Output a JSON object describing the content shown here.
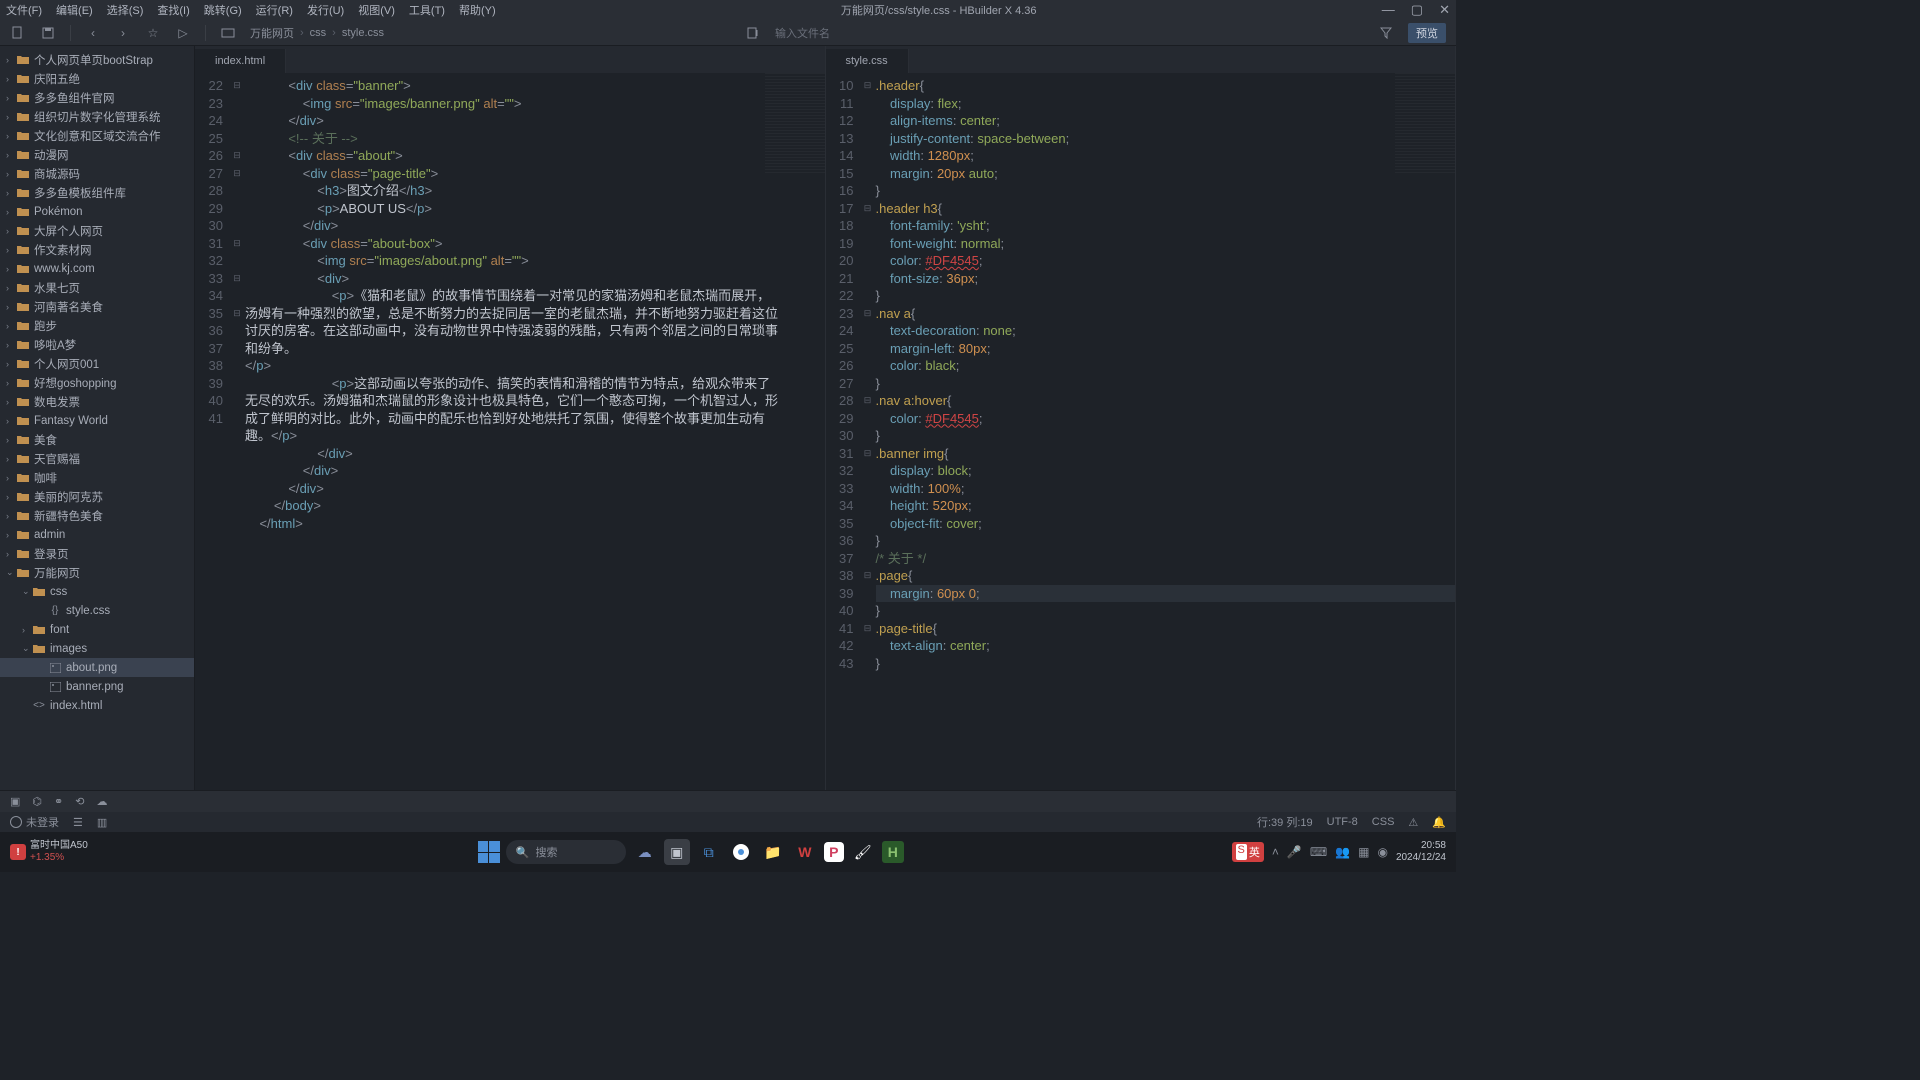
{
  "app": {
    "title": "万能网页/css/style.css - HBuilder X 4.36"
  },
  "menu": [
    "文件(F)",
    "编辑(E)",
    "选择(S)",
    "查找(I)",
    "跳转(G)",
    "运行(R)",
    "发行(U)",
    "视图(V)",
    "工具(T)",
    "帮助(Y)"
  ],
  "breadcrumb": [
    "万能网页",
    "css",
    "style.css"
  ],
  "filename_placeholder": "输入文件名",
  "preview_label": "预览",
  "tabs_left": {
    "active": "index.html"
  },
  "tabs_right": {
    "active": "style.css"
  },
  "sidebar": [
    {
      "name": "个人网页单页bootStrap",
      "type": "folder",
      "depth": 0,
      "chev": "›"
    },
    {
      "name": "庆阳五绝",
      "type": "folder",
      "depth": 0,
      "chev": "›"
    },
    {
      "name": "多多鱼组件官网",
      "type": "folder",
      "depth": 0,
      "chev": "›"
    },
    {
      "name": "组织切片数字化管理系统",
      "type": "folder",
      "depth": 0,
      "chev": "›"
    },
    {
      "name": "文化创意和区域交流合作",
      "type": "folder",
      "depth": 0,
      "chev": "›"
    },
    {
      "name": "动漫网",
      "type": "folder",
      "depth": 0,
      "chev": "›"
    },
    {
      "name": "商城源码",
      "type": "folder",
      "depth": 0,
      "chev": "›"
    },
    {
      "name": "多多鱼模板组件库",
      "type": "folder",
      "depth": 0,
      "chev": "›"
    },
    {
      "name": "Pokémon",
      "type": "folder",
      "depth": 0,
      "chev": "›"
    },
    {
      "name": "大屏个人网页",
      "type": "folder",
      "depth": 0,
      "chev": "›"
    },
    {
      "name": "作文素材网",
      "type": "folder",
      "depth": 0,
      "chev": "›"
    },
    {
      "name": "www.kj.com",
      "type": "folder",
      "depth": 0,
      "chev": "›"
    },
    {
      "name": "水果七页",
      "type": "folder",
      "depth": 0,
      "chev": "›"
    },
    {
      "name": "河南著名美食",
      "type": "folder",
      "depth": 0,
      "chev": "›"
    },
    {
      "name": "跑步",
      "type": "folder",
      "depth": 0,
      "chev": "›"
    },
    {
      "name": "哆啦A梦",
      "type": "folder",
      "depth": 0,
      "chev": "›"
    },
    {
      "name": "个人网页001",
      "type": "folder",
      "depth": 0,
      "chev": "›"
    },
    {
      "name": "好想goshopping",
      "type": "folder",
      "depth": 0,
      "chev": "›"
    },
    {
      "name": "数电发票",
      "type": "folder",
      "depth": 0,
      "chev": "›"
    },
    {
      "name": "Fantasy World",
      "type": "folder",
      "depth": 0,
      "chev": "›"
    },
    {
      "name": "美食",
      "type": "folder",
      "depth": 0,
      "chev": "›"
    },
    {
      "name": "天官赐福",
      "type": "folder",
      "depth": 0,
      "chev": "›"
    },
    {
      "name": "咖啡",
      "type": "folder",
      "depth": 0,
      "chev": "›"
    },
    {
      "name": "美丽的阿克苏",
      "type": "folder",
      "depth": 0,
      "chev": "›"
    },
    {
      "name": "新疆特色美食",
      "type": "folder",
      "depth": 0,
      "chev": "›"
    },
    {
      "name": "admin",
      "type": "folder",
      "depth": 0,
      "chev": "›"
    },
    {
      "name": "登录页",
      "type": "folder",
      "depth": 0,
      "chev": "›"
    },
    {
      "name": "万能网页",
      "type": "folder",
      "depth": 0,
      "chev": "⌄"
    },
    {
      "name": "css",
      "type": "folder",
      "depth": 1,
      "chev": "⌄"
    },
    {
      "name": "style.css",
      "type": "css",
      "depth": 2,
      "chev": ""
    },
    {
      "name": "font",
      "type": "folder",
      "depth": 1,
      "chev": "›"
    },
    {
      "name": "images",
      "type": "folder",
      "depth": 1,
      "chev": "⌄"
    },
    {
      "name": "about.png",
      "type": "img",
      "depth": 2,
      "chev": "",
      "active": true
    },
    {
      "name": "banner.png",
      "type": "img",
      "depth": 2,
      "chev": ""
    },
    {
      "name": "index.html",
      "type": "html",
      "depth": 1,
      "chev": ""
    }
  ],
  "code_left": {
    "start": 22,
    "lines": [
      {
        "n": 22,
        "fold": "⊟",
        "html": "            <span class='t-punc'>&lt;</span><span class='t-tag'>div</span> <span class='t-attr'>class</span><span class='t-punc'>=</span><span class='t-str'>\"banner\"</span><span class='t-punc'>&gt;</span>"
      },
      {
        "n": 23,
        "fold": "",
        "html": "                <span class='t-punc'>&lt;</span><span class='t-tag'>img</span> <span class='t-attr'>src</span><span class='t-punc'>=</span><span class='t-str'>\"images/banner.png\"</span> <span class='t-attr'>alt</span><span class='t-punc'>=</span><span class='t-str'>\"\"</span><span class='t-punc'>&gt;</span>"
      },
      {
        "n": 24,
        "fold": "",
        "html": "            <span class='t-punc'>&lt;/</span><span class='t-tag'>div</span><span class='t-punc'>&gt;</span>"
      },
      {
        "n": 25,
        "fold": "",
        "html": "            <span class='t-comm'>&lt;!-- 关于 --&gt;</span>"
      },
      {
        "n": 26,
        "fold": "⊟",
        "html": "            <span class='t-punc'>&lt;</span><span class='t-tag'>div</span> <span class='t-attr'>class</span><span class='t-punc'>=</span><span class='t-str'>\"about\"</span><span class='t-punc'>&gt;</span>"
      },
      {
        "n": 27,
        "fold": "⊟",
        "html": "                <span class='t-punc'>&lt;</span><span class='t-tag'>div</span> <span class='t-attr'>class</span><span class='t-punc'>=</span><span class='t-str'>\"page-title\"</span><span class='t-punc'>&gt;</span>"
      },
      {
        "n": 28,
        "fold": "",
        "html": "                    <span class='t-punc'>&lt;</span><span class='t-tag'>h3</span><span class='t-punc'>&gt;</span><span class='t-text'>图文介绍</span><span class='t-punc'>&lt;/</span><span class='t-tag'>h3</span><span class='t-punc'>&gt;</span>"
      },
      {
        "n": 29,
        "fold": "",
        "html": "                    <span class='t-punc'>&lt;</span><span class='t-tag'>p</span><span class='t-punc'>&gt;</span><span class='t-text'>ABOUT US</span><span class='t-punc'>&lt;/</span><span class='t-tag'>p</span><span class='t-punc'>&gt;</span>"
      },
      {
        "n": 30,
        "fold": "",
        "html": "                <span class='t-punc'>&lt;/</span><span class='t-tag'>div</span><span class='t-punc'>&gt;</span>"
      },
      {
        "n": 31,
        "fold": "⊟",
        "html": "                <span class='t-punc'>&lt;</span><span class='t-tag'>div</span> <span class='t-attr'>class</span><span class='t-punc'>=</span><span class='t-str'>\"about-box\"</span><span class='t-punc'>&gt;</span>"
      },
      {
        "n": 32,
        "fold": "",
        "html": "                    <span class='t-punc'>&lt;</span><span class='t-tag'>img</span> <span class='t-attr'>src</span><span class='t-punc'>=</span><span class='t-str'>\"images/about.png\"</span> <span class='t-attr'>alt</span><span class='t-punc'>=</span><span class='t-str'>\"\"</span><span class='t-punc'>&gt;</span>"
      },
      {
        "n": 33,
        "fold": "⊟",
        "html": "                    <span class='t-punc'>&lt;</span><span class='t-tag'>div</span><span class='t-punc'>&gt;</span>"
      },
      {
        "n": 34,
        "fold": "",
        "wrap": true,
        "html": "                        <span class='t-punc'>&lt;</span><span class='t-tag'>p</span><span class='t-punc'>&gt;</span><span class='t-text'>《猫和老鼠》的故事情节围绕着一对常见的家猫汤姆和老鼠杰瑞而展开，汤姆有一种强烈的欲望，总是不断努力的去捉同居一室的老鼠杰瑞，并不断地努力驱赶着这位讨厌的房客。在这部动画中，没有动物世界中恃强凌弱的残酷，只有两个邻居之间的日常琐事和纷争。</span>"
      },
      {
        "n": 35,
        "fold": "⊟",
        "html": "<span class='t-punc'>&lt;/</span><span class='t-tag'>p</span><span class='t-punc'>&gt;</span>"
      },
      {
        "n": 36,
        "fold": "",
        "wrap": true,
        "html": "                        <span class='t-punc'>&lt;</span><span class='t-tag'>p</span><span class='t-punc'>&gt;</span><span class='t-text'>这部动画以夸张的动作、搞笑的表情和滑稽的情节为特点，给观众带来了无尽的欢乐。汤姆猫和杰瑞鼠的形象设计也极具特色，它们一个憨态可掬，一个机智过人，形成了鲜明的对比。此外，动画中的配乐也恰到好处地烘托了氛围，使得整个故事更加生动有趣。</span><span class='t-punc'>&lt;/</span><span class='t-tag'>p</span><span class='t-punc'>&gt;</span>"
      },
      {
        "n": 37,
        "fold": "",
        "html": "                    <span class='t-punc'>&lt;/</span><span class='t-tag'>div</span><span class='t-punc'>&gt;</span>"
      },
      {
        "n": 38,
        "fold": "",
        "html": "                <span class='t-punc'>&lt;/</span><span class='t-tag'>div</span><span class='t-punc'>&gt;</span>"
      },
      {
        "n": 39,
        "fold": "",
        "html": "            <span class='t-punc'>&lt;/</span><span class='t-tag'>div</span><span class='t-punc'>&gt;</span>"
      },
      {
        "n": 40,
        "fold": "",
        "html": "        <span class='t-punc'>&lt;/</span><span class='t-tag'>body</span><span class='t-punc'>&gt;</span>"
      },
      {
        "n": 41,
        "fold": "",
        "html": "    <span class='t-punc'>&lt;/</span><span class='t-tag'>html</span><span class='t-punc'>&gt;</span>"
      }
    ]
  },
  "code_right": {
    "start": 10,
    "lines": [
      {
        "n": 10,
        "fold": "⊟",
        "html": "<span class='t-sel'>.header</span><span class='t-punc'>{</span>"
      },
      {
        "n": 11,
        "fold": "",
        "html": "    <span class='t-prop'>display</span><span class='t-punc'>:</span> <span class='t-val'>flex</span><span class='t-punc'>;</span>"
      },
      {
        "n": 12,
        "fold": "",
        "html": "    <span class='t-prop'>align-items</span><span class='t-punc'>:</span> <span class='t-val'>center</span><span class='t-punc'>;</span>"
      },
      {
        "n": 13,
        "fold": "",
        "html": "    <span class='t-prop'>justify-content</span><span class='t-punc'>:</span> <span class='t-val'>space-between</span><span class='t-punc'>;</span>"
      },
      {
        "n": 14,
        "fold": "",
        "html": "    <span class='t-prop'>width</span><span class='t-punc'>:</span> <span class='t-num'>1280px</span><span class='t-punc'>;</span>"
      },
      {
        "n": 15,
        "fold": "",
        "html": "    <span class='t-prop'>margin</span><span class='t-punc'>:</span> <span class='t-num'>20px</span> <span class='t-val'>auto</span><span class='t-punc'>;</span>"
      },
      {
        "n": 16,
        "fold": "",
        "html": "<span class='t-punc'>}</span>"
      },
      {
        "n": 17,
        "fold": "⊟",
        "html": "<span class='t-sel'>.header h3</span><span class='t-punc'>{</span>"
      },
      {
        "n": 18,
        "fold": "",
        "html": "    <span class='t-prop'>font-family</span><span class='t-punc'>:</span> <span class='t-str'>'ysht'</span><span class='t-punc'>;</span>"
      },
      {
        "n": 19,
        "fold": "",
        "html": "    <span class='t-prop'>font-weight</span><span class='t-punc'>:</span> <span class='t-val'>normal</span><span class='t-punc'>;</span>"
      },
      {
        "n": 20,
        "fold": "",
        "html": "    <span class='t-prop'>color</span><span class='t-punc'>:</span> <span class='t-hex'>#DF4545</span><span class='t-punc'>;</span>"
      },
      {
        "n": 21,
        "fold": "",
        "html": "    <span class='t-prop'>font-size</span><span class='t-punc'>:</span> <span class='t-num'>36px</span><span class='t-punc'>;</span>"
      },
      {
        "n": 22,
        "fold": "",
        "html": "<span class='t-punc'>}</span>"
      },
      {
        "n": 23,
        "fold": "⊟",
        "html": "<span class='t-sel'>.nav a</span><span class='t-punc'>{</span>"
      },
      {
        "n": 24,
        "fold": "",
        "html": "    <span class='t-prop'>text-decoration</span><span class='t-punc'>:</span> <span class='t-val'>none</span><span class='t-punc'>;</span>"
      },
      {
        "n": 25,
        "fold": "",
        "html": "    <span class='t-prop'>margin-left</span><span class='t-punc'>:</span> <span class='t-num'>80px</span><span class='t-punc'>;</span>"
      },
      {
        "n": 26,
        "fold": "",
        "html": "    <span class='t-prop'>color</span><span class='t-punc'>:</span> <span class='t-val'>black</span><span class='t-punc'>;</span>"
      },
      {
        "n": 27,
        "fold": "",
        "html": "<span class='t-punc'>}</span>"
      },
      {
        "n": 28,
        "fold": "⊟",
        "html": "<span class='t-sel'>.nav a:hover</span><span class='t-punc'>{</span>"
      },
      {
        "n": 29,
        "fold": "",
        "html": "    <span class='t-prop'>color</span><span class='t-punc'>:</span> <span class='t-hex'>#DF4545</span><span class='t-punc'>;</span>"
      },
      {
        "n": 30,
        "fold": "",
        "html": "<span class='t-punc'>}</span>"
      },
      {
        "n": 31,
        "fold": "⊟",
        "html": "<span class='t-sel'>.banner</span> <span class='t-sel'>img</span><span class='t-punc'>{</span>"
      },
      {
        "n": 32,
        "fold": "",
        "html": "    <span class='t-prop'>display</span><span class='t-punc'>:</span> <span class='t-val'>block</span><span class='t-punc'>;</span>"
      },
      {
        "n": 33,
        "fold": "",
        "html": "    <span class='t-prop'>width</span><span class='t-punc'>:</span> <span class='t-num'>100%</span><span class='t-punc'>;</span>"
      },
      {
        "n": 34,
        "fold": "",
        "html": "    <span class='t-prop'>height</span><span class='t-punc'>:</span> <span class='t-num'>520px</span><span class='t-punc'>;</span>"
      },
      {
        "n": 35,
        "fold": "",
        "html": "    <span class='t-prop'>object-fit</span><span class='t-punc'>:</span> <span class='t-val'>cover</span><span class='t-punc'>;</span>"
      },
      {
        "n": 36,
        "fold": "",
        "html": "<span class='t-punc'>}</span>"
      },
      {
        "n": 37,
        "fold": "",
        "html": "<span class='t-comm'>/* 关于 */</span>"
      },
      {
        "n": 38,
        "fold": "⊟",
        "html": "<span class='t-sel'>.page</span><span class='t-punc'>{</span>"
      },
      {
        "n": 39,
        "fold": "",
        "hl": true,
        "html": "    <span class='t-prop'>margin</span><span class='t-punc'>:</span> <span class='t-num'>60px</span> <span class='t-num'>0</span><span class='t-punc'>;</span>"
      },
      {
        "n": 40,
        "fold": "",
        "html": "<span class='t-punc'>}</span>"
      },
      {
        "n": 41,
        "fold": "⊟",
        "html": "<span class='t-sel'>.page-title</span><span class='t-punc'>{</span>"
      },
      {
        "n": 42,
        "fold": "",
        "html": "    <span class='t-prop'>text-align</span><span class='t-punc'>:</span> <span class='t-val'>center</span><span class='t-punc'>;</span>"
      },
      {
        "n": 43,
        "fold": "",
        "html": "<span class='t-punc'>}</span>"
      }
    ]
  },
  "status": {
    "login": "未登录",
    "pos": "行:39  列:19",
    "enc": "UTF-8",
    "lang": "CSS"
  },
  "taskbar": {
    "stock_name": "富时中国A50",
    "stock_pct": "+1.35%",
    "search": "搜索",
    "time": "20:58",
    "date": "2024/12/24",
    "ime": "英"
  }
}
